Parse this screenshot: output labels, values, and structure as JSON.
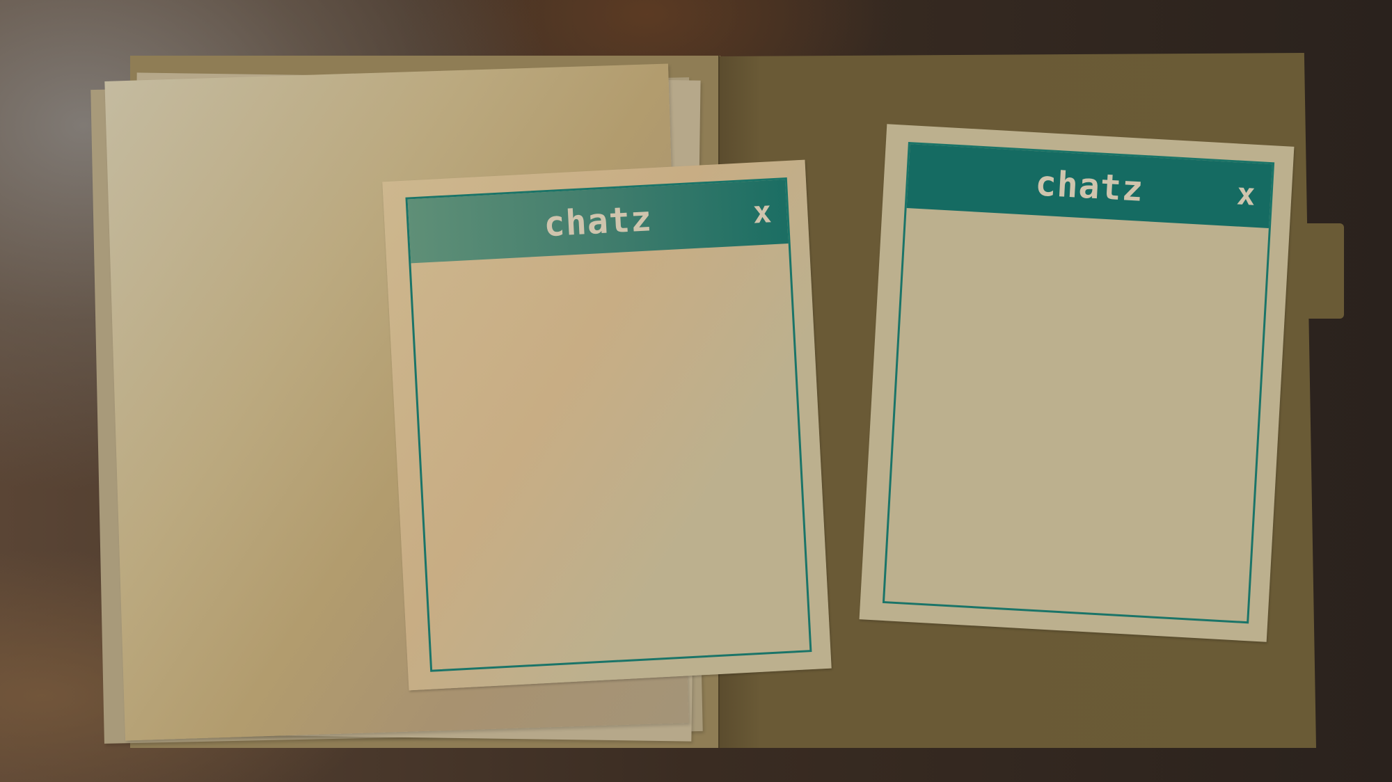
{
  "chat_windows": [
    {
      "title": "chatz",
      "close_label": "x"
    },
    {
      "title": "chatz",
      "close_label": "x"
    }
  ]
}
